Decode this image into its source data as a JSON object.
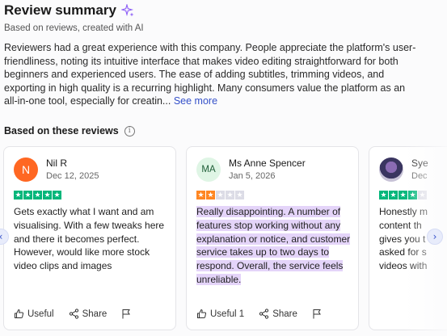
{
  "summary": {
    "title": "Review summary",
    "subtitle": "Based on reviews, created with AI",
    "text": "Reviewers had a great experience with this company. People appreciate the platform's user-friendliness, noting its intuitive interface that makes video editing straightforward for both beginners and experienced users. The ease of adding subtitles, trimming videos, and exporting in high quality is a recurring highlight. Many consumers value the platform as an all-in-one tool, especially for creatin...",
    "see_more": "See more"
  },
  "reviews_section": {
    "heading": "Based on these reviews",
    "info_icon": "i"
  },
  "colors": {
    "star_green": "#00b67a",
    "star_orange": "#ff8622",
    "highlight": "#e4d4f9",
    "link": "#3450c9"
  },
  "reviews": [
    {
      "initials": "N",
      "name": "Nil R",
      "date": "Dec 12, 2025",
      "rating": 5,
      "text": "Gets exactly what I want and am visualising. With a few tweaks here and there it becomes perfect. However, would like more stock video clips and images",
      "useful_label": "Useful",
      "share_label": "Share"
    },
    {
      "initials": "MA",
      "name": "Ms Anne Spencer",
      "date": "Jan 5, 2026",
      "rating": 2,
      "text": "Really disappointing. A number of features stop working without any explanation or notice, and customer service takes up to two days to respond. Overall, the service feels unreliable.",
      "useful_label": "Useful 1",
      "share_label": "Share"
    },
    {
      "name": "Sye",
      "date": "Dec",
      "rating": 4,
      "text_lines": [
        "Honestly m",
        "content th",
        "gives you t",
        "asked for s",
        "videos with"
      ]
    }
  ],
  "icons": {
    "sparkle": "sparkle-icon",
    "info": "info-icon",
    "useful": "thumbs-up-icon",
    "share": "share-icon",
    "flag": "flag-icon",
    "prev": "chevron-left-icon",
    "next": "chevron-right-icon"
  }
}
